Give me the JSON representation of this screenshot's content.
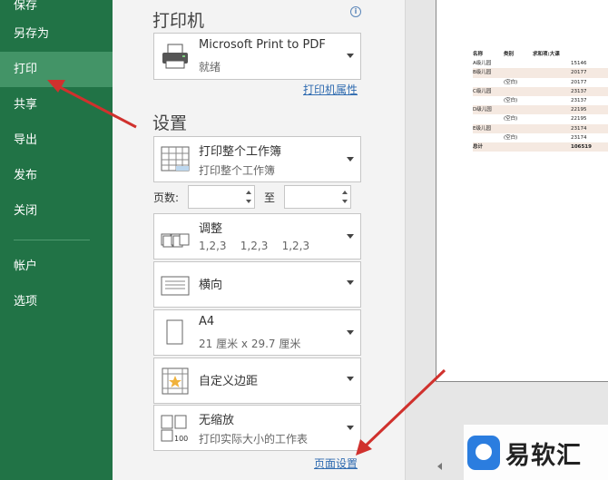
{
  "sidebar": {
    "top_cut_label": "保存",
    "items": [
      {
        "label": "另存为"
      },
      {
        "label": "打印",
        "active": true
      },
      {
        "label": "共享"
      },
      {
        "label": "导出"
      },
      {
        "label": "发布"
      },
      {
        "label": "关闭"
      },
      {
        "label": "帐户"
      },
      {
        "label": "选项"
      }
    ]
  },
  "printer": {
    "title": "打印机",
    "name": "Microsoft Print to PDF",
    "status": "就绪",
    "properties_link": "打印机属性"
  },
  "settings": {
    "title": "设置",
    "scope": {
      "main": "打印整个工作簿",
      "sub": "打印整个工作簿"
    },
    "pages_label": "页数:",
    "to_label": "至",
    "pages_from": "",
    "pages_to": "",
    "collate": {
      "main": "调整",
      "sub": "1,2,3    1,2,3    1,2,3"
    },
    "orientation": {
      "main": "横向"
    },
    "paper": {
      "main": "A4",
      "sub": "21 厘米 x 29.7 厘米"
    },
    "margins": {
      "main": "自定义边距"
    },
    "scaling": {
      "main": "无缩放",
      "sub": "打印实际大小的工作表"
    },
    "page_setup_link": "页面设置"
  },
  "preview": {
    "headers": [
      "名称",
      "类别",
      "求和项:大课"
    ],
    "rows": [
      {
        "c1": "A级儿园",
        "c2": "",
        "c3": "15146",
        "shade": false
      },
      {
        "c1": "B级儿园",
        "c2": "",
        "c3": "20177",
        "shade": true
      },
      {
        "c1": "",
        "c2": "(空白)",
        "c3": "20177",
        "shade": false
      },
      {
        "c1": "C级儿园",
        "c2": "",
        "c3": "23137",
        "shade": true
      },
      {
        "c1": "",
        "c2": "(空白)",
        "c3": "23137",
        "shade": false
      },
      {
        "c1": "D级儿园",
        "c2": "",
        "c3": "22195",
        "shade": true
      },
      {
        "c1": "",
        "c2": "(空白)",
        "c3": "22195",
        "shade": false
      },
      {
        "c1": "E级儿园",
        "c2": "",
        "c3": "23174",
        "shade": true
      },
      {
        "c1": "",
        "c2": "(空白)",
        "c3": "23174",
        "shade": false
      },
      {
        "c1": "总计",
        "c2": "",
        "c3": "106519",
        "shade": true
      }
    ]
  },
  "watermark": {
    "text": "易软汇"
  },
  "colors": {
    "sidebar": "#217346",
    "sidebar_active": "#439467",
    "arrow": "#d0312d",
    "link": "#2f6bb0"
  }
}
